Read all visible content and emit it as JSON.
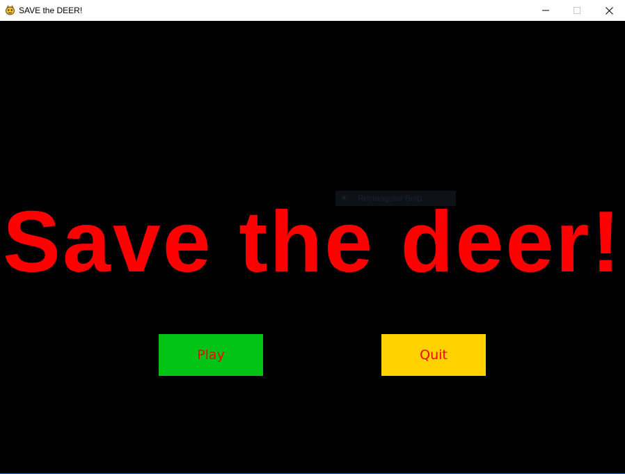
{
  "window": {
    "title": "SAVE the DEER!",
    "app_icon": "pygame-snake-icon",
    "controls": {
      "minimize_icon": "minimize-icon",
      "maximize_icon": "maximize-icon",
      "close_icon": "close-icon"
    }
  },
  "game": {
    "background_color": "#000000",
    "headline": "Save the deer!",
    "headline_color": "#ff0000",
    "buttons": {
      "play": {
        "label": "Play",
        "color": "#00c316",
        "text_color": "#ff0000"
      },
      "quit": {
        "label": "Quit",
        "color": "#ffd200",
        "text_color": "#ff0000"
      }
    }
  },
  "overlay": {
    "snip_label": "Rectangular Snip"
  }
}
